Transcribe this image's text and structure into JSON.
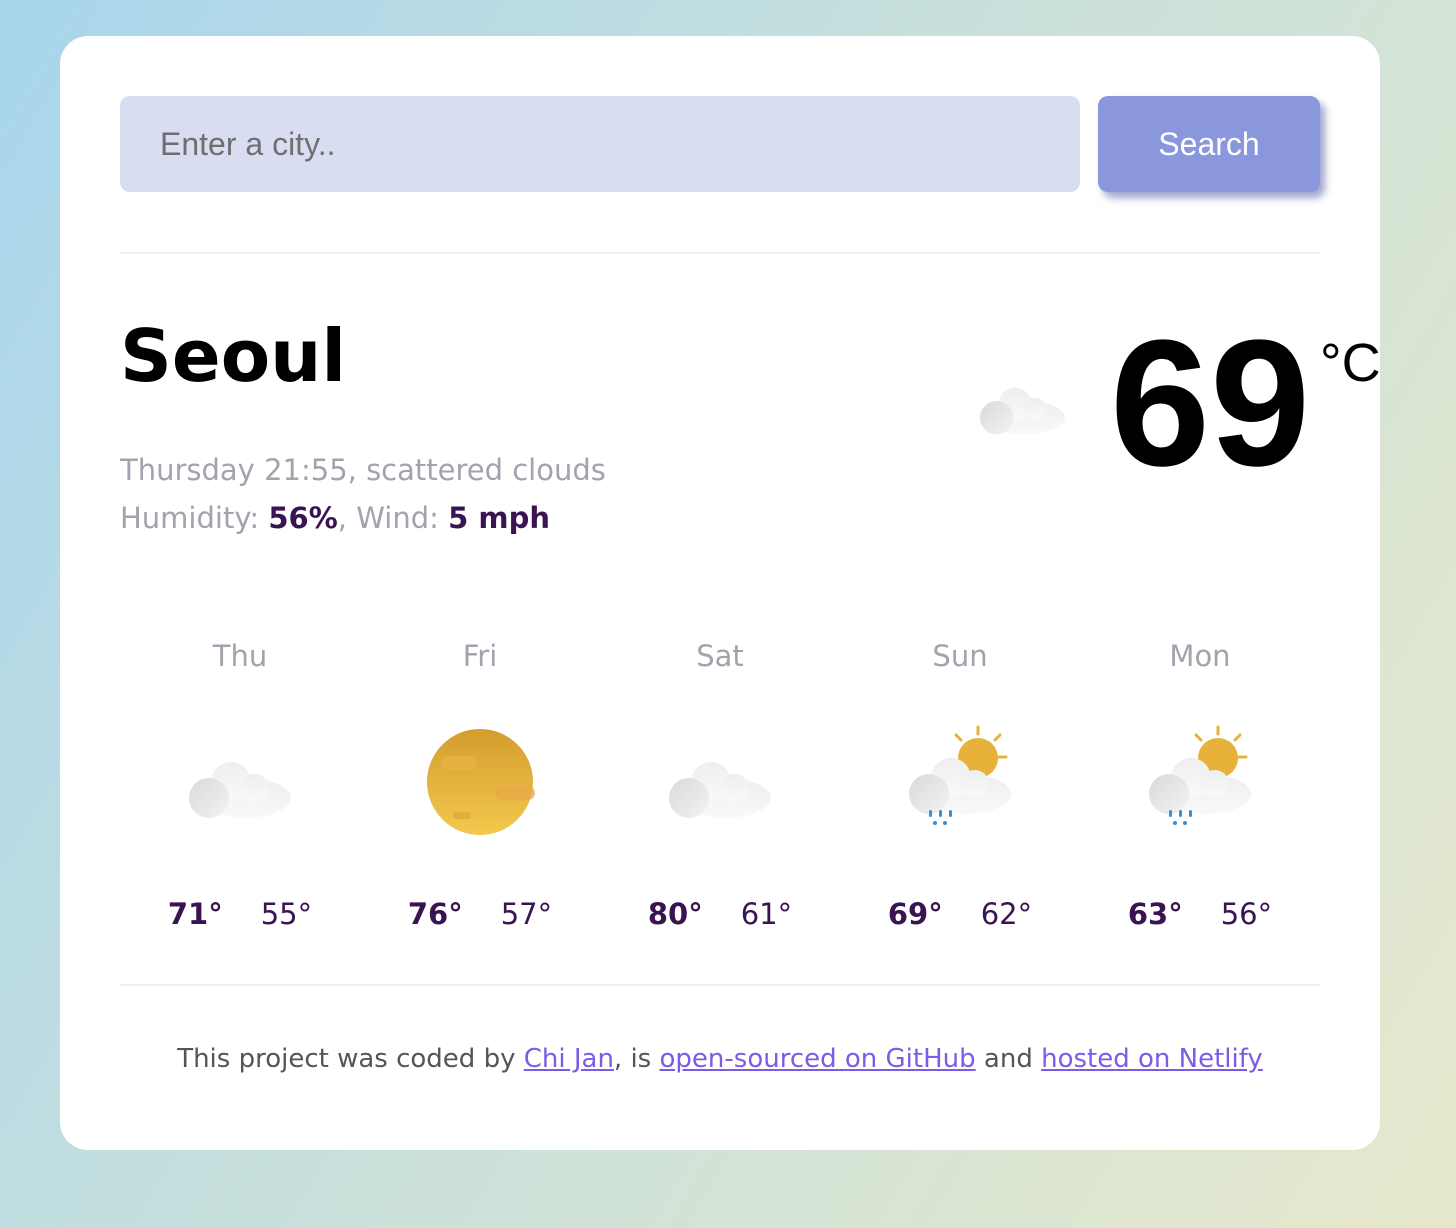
{
  "search": {
    "placeholder": "Enter a city..",
    "button_label": "Search"
  },
  "current": {
    "city": "Seoul",
    "date_description": "Thursday 21:55, scattered clouds",
    "humidity_label": "Humidity: ",
    "humidity_value": "56%",
    "wind_label": ", Wind: ",
    "wind_value": "5 mph",
    "temperature": "69",
    "unit": "°C",
    "icon": "scattered-clouds-icon"
  },
  "forecast": [
    {
      "day": "Thu",
      "max": "71°",
      "min": "55°",
      "icon": "cloud-icon"
    },
    {
      "day": "Fri",
      "max": "76°",
      "min": "57°",
      "icon": "sun-haze-icon"
    },
    {
      "day": "Sat",
      "max": "80°",
      "min": "61°",
      "icon": "cloud-icon"
    },
    {
      "day": "Sun",
      "max": "69°",
      "min": "62°",
      "icon": "sun-cloud-rain-icon"
    },
    {
      "day": "Mon",
      "max": "63°",
      "min": "56°",
      "icon": "sun-cloud-rain-icon"
    }
  ],
  "footer": {
    "prefix": "This project was coded by ",
    "author_link": "Chi Jan",
    "middle": ", is ",
    "github_link": "open-sourced on GitHub",
    "and": " and ",
    "netlify_link": "hosted on Netlify"
  },
  "colors": {
    "accent": "#8a97dd",
    "input_bg": "#d9ddf2",
    "emphasis": "#3a1452",
    "link": "#7a5ce6",
    "muted": "#a3a3ad"
  }
}
